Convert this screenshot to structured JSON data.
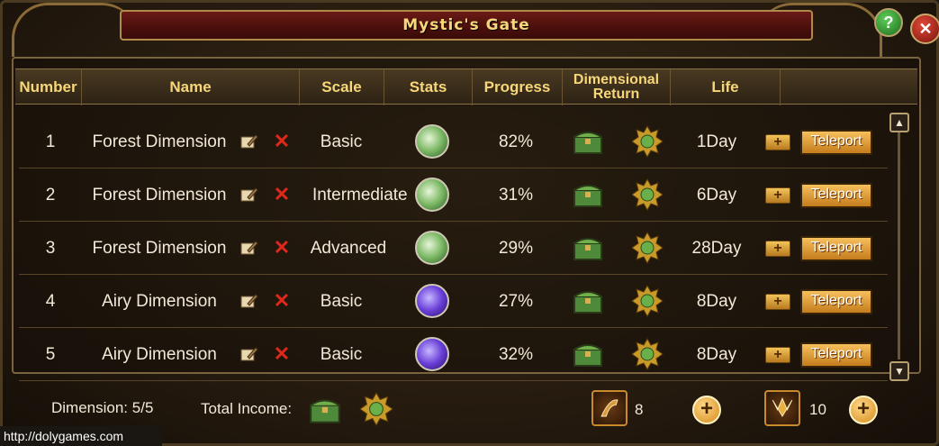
{
  "window": {
    "title": "Mystic's Gate"
  },
  "controls": {
    "help_label": "?",
    "close_label": "✕"
  },
  "columns": {
    "number": "Number",
    "name": "Name",
    "scale": "Scale",
    "stats": "Stats",
    "progress": "Progress",
    "dimensional_return_line1": "Dimensional",
    "dimensional_return_line2": "Return",
    "life": "Life"
  },
  "rows": [
    {
      "number": "1",
      "name": "Forest Dimension",
      "scale": "Basic",
      "stat_icon": "green-orb-icon",
      "progress": "82%",
      "life": "1Day",
      "action": "Teleport"
    },
    {
      "number": "2",
      "name": "Forest Dimension",
      "scale": "Intermediate",
      "stat_icon": "green-orb-icon",
      "progress": "31%",
      "life": "6Day",
      "action": "Teleport"
    },
    {
      "number": "3",
      "name": "Forest Dimension",
      "scale": "Advanced",
      "stat_icon": "green-orb-icon",
      "progress": "29%",
      "life": "28Day",
      "action": "Teleport"
    },
    {
      "number": "4",
      "name": "Airy Dimension",
      "scale": "Basic",
      "stat_icon": "purple-orb-icon",
      "progress": "27%",
      "life": "8Day",
      "action": "Teleport"
    },
    {
      "number": "5",
      "name": "Airy Dimension",
      "scale": "Basic",
      "stat_icon": "purple-orb-icon",
      "progress": "32%",
      "life": "8Day",
      "action": "Teleport"
    }
  ],
  "row_icons": {
    "edit": "edit-icon",
    "delete": "delete-x-icon",
    "chest": "chest-icon",
    "gear": "gear-icon",
    "plus": "+"
  },
  "footer": {
    "dimension_label": "Dimension:",
    "dimension_value": "5/5",
    "total_income_label": "Total Income:",
    "item1_count": "8",
    "item2_count": "10",
    "plus_label": "+"
  },
  "watermark": "http://dolygames.com",
  "colors": {
    "title_gold": "#f7d77a",
    "title_bar_red": "#6b1a16",
    "delete_red": "#e0281a",
    "button_orange": "#f6c05c"
  }
}
